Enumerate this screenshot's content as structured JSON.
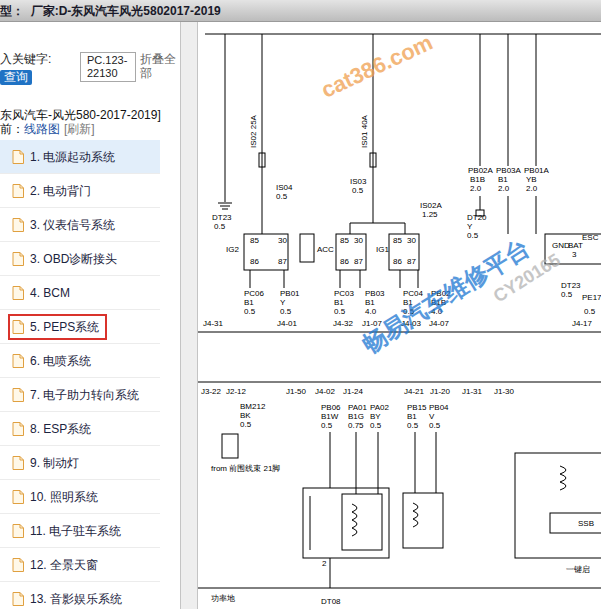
{
  "window": {
    "title": "型：  厂家:D-东风汽车风光5802017-2019"
  },
  "search": {
    "label": "入关键字:",
    "value": "PC.123-22130",
    "collapse": "折叠全部",
    "button": "查询"
  },
  "tree": {
    "root": "东风汽车-风光580-2017-2019]",
    "current_prefix": "前：",
    "current": "线路图",
    "refresh": "[刷新]"
  },
  "sidebar": {
    "items": [
      {
        "label": "1. 电源起动系统",
        "selected": true,
        "annotated": false
      },
      {
        "label": "2. 电动背门",
        "selected": false,
        "annotated": false
      },
      {
        "label": "3. 仪表信号系统",
        "selected": false,
        "annotated": false
      },
      {
        "label": "3. OBD诊断接头",
        "selected": false,
        "annotated": false
      },
      {
        "label": "4. BCM",
        "selected": false,
        "annotated": false
      },
      {
        "label": "5. PEPS系统",
        "selected": false,
        "annotated": true
      },
      {
        "label": "6. 电喷系统",
        "selected": false,
        "annotated": false
      },
      {
        "label": "7. 电子助力转向系统",
        "selected": false,
        "annotated": false
      },
      {
        "label": "8. ESP系统",
        "selected": false,
        "annotated": false
      },
      {
        "label": "9. 制动灯",
        "selected": false,
        "annotated": false
      },
      {
        "label": "10. 照明系统",
        "selected": false,
        "annotated": false
      },
      {
        "label": "11. 电子驻车系统",
        "selected": false,
        "annotated": false
      },
      {
        "label": "12. 全景天窗",
        "selected": false,
        "annotated": false
      },
      {
        "label": "13. 音影娱乐系统",
        "selected": false,
        "annotated": false
      }
    ]
  },
  "diagram": {
    "labels": [
      "IS02 25A",
      "IS01 40A",
      "DT23",
      "0.5",
      "IS04",
      "0.5",
      "85",
      "30",
      "86",
      "87",
      "IG2",
      "IS03",
      "0.5",
      "85",
      "30",
      "86",
      "87",
      "ACC",
      "85",
      "30",
      "86",
      "87",
      "IG1",
      "IS02A",
      "1.25",
      "DT20",
      "Y",
      "0.5",
      "PB02A",
      "B1B",
      "2.0",
      "PB03A",
      "B1",
      "2.0",
      "PB01A",
      "YB",
      "2.0",
      "GND",
      "BAT",
      "3",
      "ESC",
      "DT23",
      "0.5",
      "PC06",
      "B1",
      "0.5",
      "PB01",
      "Y",
      "0.5",
      "PC03",
      "B1",
      "0.5",
      "PB03",
      "B1",
      "4.0",
      "PC04",
      "B1",
      "0.5",
      "PB02",
      "B1B",
      "4.0",
      "PE17",
      "0.5",
      "J4-31",
      "J4-01",
      "J4-32",
      "J1-07",
      "J4-03",
      "J4-07",
      "J4-17",
      "J3-22",
      "J2-12",
      "J1-50",
      "J4-02",
      "J1-24",
      "J4-21",
      "J1-20",
      "J1-31",
      "J1-30",
      "BM212",
      "BK",
      "0.5",
      "PB06",
      "B1W",
      "0.5",
      "PA01",
      "B1G",
      "0.75",
      "PA02",
      "BY",
      "0.5",
      "PB15",
      "B1",
      "0.5",
      "PB04",
      "V",
      "0.5",
      "from 前围线束 21脚",
      "SSB",
      "一键启",
      "功率地",
      "DT08",
      "2"
    ],
    "watermarks": [
      {
        "text": "cat386.com",
        "color": "#f0a050"
      },
      {
        "text": "畅易汽车维修平台",
        "color": "#1e78d2"
      },
      {
        "text": "CY20165",
        "color": "#b4b4b4"
      }
    ]
  }
}
